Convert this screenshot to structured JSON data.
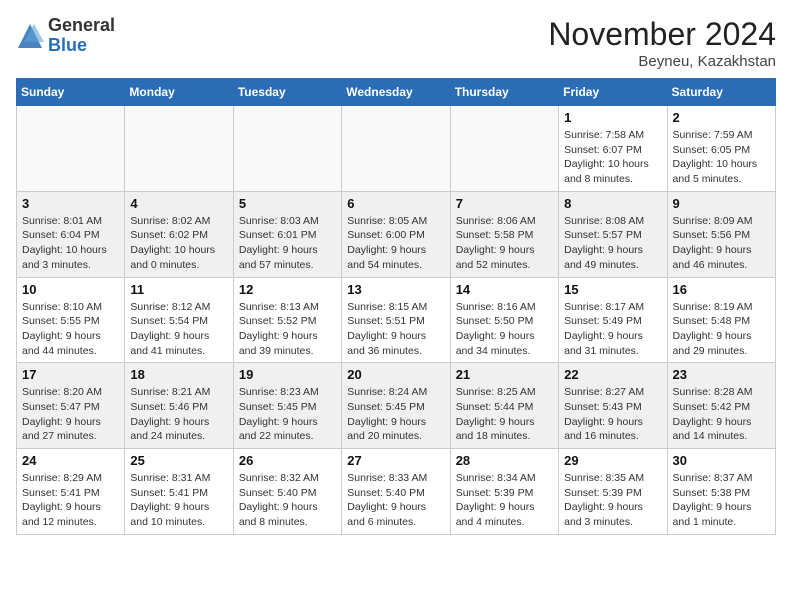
{
  "header": {
    "logo": {
      "general": "General",
      "blue": "Blue"
    },
    "title": "November 2024",
    "location": "Beyneu, Kazakhstan"
  },
  "weekdays": [
    "Sunday",
    "Monday",
    "Tuesday",
    "Wednesday",
    "Thursday",
    "Friday",
    "Saturday"
  ],
  "weeks": [
    {
      "shaded": false,
      "days": [
        {
          "date": "",
          "sunrise": "",
          "sunset": "",
          "daylight": ""
        },
        {
          "date": "",
          "sunrise": "",
          "sunset": "",
          "daylight": ""
        },
        {
          "date": "",
          "sunrise": "",
          "sunset": "",
          "daylight": ""
        },
        {
          "date": "",
          "sunrise": "",
          "sunset": "",
          "daylight": ""
        },
        {
          "date": "",
          "sunrise": "",
          "sunset": "",
          "daylight": ""
        },
        {
          "date": "1",
          "sunrise": "Sunrise: 7:58 AM",
          "sunset": "Sunset: 6:07 PM",
          "daylight": "Daylight: 10 hours and 8 minutes."
        },
        {
          "date": "2",
          "sunrise": "Sunrise: 7:59 AM",
          "sunset": "Sunset: 6:05 PM",
          "daylight": "Daylight: 10 hours and 5 minutes."
        }
      ]
    },
    {
      "shaded": true,
      "days": [
        {
          "date": "3",
          "sunrise": "Sunrise: 8:01 AM",
          "sunset": "Sunset: 6:04 PM",
          "daylight": "Daylight: 10 hours and 3 minutes."
        },
        {
          "date": "4",
          "sunrise": "Sunrise: 8:02 AM",
          "sunset": "Sunset: 6:02 PM",
          "daylight": "Daylight: 10 hours and 0 minutes."
        },
        {
          "date": "5",
          "sunrise": "Sunrise: 8:03 AM",
          "sunset": "Sunset: 6:01 PM",
          "daylight": "Daylight: 9 hours and 57 minutes."
        },
        {
          "date": "6",
          "sunrise": "Sunrise: 8:05 AM",
          "sunset": "Sunset: 6:00 PM",
          "daylight": "Daylight: 9 hours and 54 minutes."
        },
        {
          "date": "7",
          "sunrise": "Sunrise: 8:06 AM",
          "sunset": "Sunset: 5:58 PM",
          "daylight": "Daylight: 9 hours and 52 minutes."
        },
        {
          "date": "8",
          "sunrise": "Sunrise: 8:08 AM",
          "sunset": "Sunset: 5:57 PM",
          "daylight": "Daylight: 9 hours and 49 minutes."
        },
        {
          "date": "9",
          "sunrise": "Sunrise: 8:09 AM",
          "sunset": "Sunset: 5:56 PM",
          "daylight": "Daylight: 9 hours and 46 minutes."
        }
      ]
    },
    {
      "shaded": false,
      "days": [
        {
          "date": "10",
          "sunrise": "Sunrise: 8:10 AM",
          "sunset": "Sunset: 5:55 PM",
          "daylight": "Daylight: 9 hours and 44 minutes."
        },
        {
          "date": "11",
          "sunrise": "Sunrise: 8:12 AM",
          "sunset": "Sunset: 5:54 PM",
          "daylight": "Daylight: 9 hours and 41 minutes."
        },
        {
          "date": "12",
          "sunrise": "Sunrise: 8:13 AM",
          "sunset": "Sunset: 5:52 PM",
          "daylight": "Daylight: 9 hours and 39 minutes."
        },
        {
          "date": "13",
          "sunrise": "Sunrise: 8:15 AM",
          "sunset": "Sunset: 5:51 PM",
          "daylight": "Daylight: 9 hours and 36 minutes."
        },
        {
          "date": "14",
          "sunrise": "Sunrise: 8:16 AM",
          "sunset": "Sunset: 5:50 PM",
          "daylight": "Daylight: 9 hours and 34 minutes."
        },
        {
          "date": "15",
          "sunrise": "Sunrise: 8:17 AM",
          "sunset": "Sunset: 5:49 PM",
          "daylight": "Daylight: 9 hours and 31 minutes."
        },
        {
          "date": "16",
          "sunrise": "Sunrise: 8:19 AM",
          "sunset": "Sunset: 5:48 PM",
          "daylight": "Daylight: 9 hours and 29 minutes."
        }
      ]
    },
    {
      "shaded": true,
      "days": [
        {
          "date": "17",
          "sunrise": "Sunrise: 8:20 AM",
          "sunset": "Sunset: 5:47 PM",
          "daylight": "Daylight: 9 hours and 27 minutes."
        },
        {
          "date": "18",
          "sunrise": "Sunrise: 8:21 AM",
          "sunset": "Sunset: 5:46 PM",
          "daylight": "Daylight: 9 hours and 24 minutes."
        },
        {
          "date": "19",
          "sunrise": "Sunrise: 8:23 AM",
          "sunset": "Sunset: 5:45 PM",
          "daylight": "Daylight: 9 hours and 22 minutes."
        },
        {
          "date": "20",
          "sunrise": "Sunrise: 8:24 AM",
          "sunset": "Sunset: 5:45 PM",
          "daylight": "Daylight: 9 hours and 20 minutes."
        },
        {
          "date": "21",
          "sunrise": "Sunrise: 8:25 AM",
          "sunset": "Sunset: 5:44 PM",
          "daylight": "Daylight: 9 hours and 18 minutes."
        },
        {
          "date": "22",
          "sunrise": "Sunrise: 8:27 AM",
          "sunset": "Sunset: 5:43 PM",
          "daylight": "Daylight: 9 hours and 16 minutes."
        },
        {
          "date": "23",
          "sunrise": "Sunrise: 8:28 AM",
          "sunset": "Sunset: 5:42 PM",
          "daylight": "Daylight: 9 hours and 14 minutes."
        }
      ]
    },
    {
      "shaded": false,
      "days": [
        {
          "date": "24",
          "sunrise": "Sunrise: 8:29 AM",
          "sunset": "Sunset: 5:41 PM",
          "daylight": "Daylight: 9 hours and 12 minutes."
        },
        {
          "date": "25",
          "sunrise": "Sunrise: 8:31 AM",
          "sunset": "Sunset: 5:41 PM",
          "daylight": "Daylight: 9 hours and 10 minutes."
        },
        {
          "date": "26",
          "sunrise": "Sunrise: 8:32 AM",
          "sunset": "Sunset: 5:40 PM",
          "daylight": "Daylight: 9 hours and 8 minutes."
        },
        {
          "date": "27",
          "sunrise": "Sunrise: 8:33 AM",
          "sunset": "Sunset: 5:40 PM",
          "daylight": "Daylight: 9 hours and 6 minutes."
        },
        {
          "date": "28",
          "sunrise": "Sunrise: 8:34 AM",
          "sunset": "Sunset: 5:39 PM",
          "daylight": "Daylight: 9 hours and 4 minutes."
        },
        {
          "date": "29",
          "sunrise": "Sunrise: 8:35 AM",
          "sunset": "Sunset: 5:39 PM",
          "daylight": "Daylight: 9 hours and 3 minutes."
        },
        {
          "date": "30",
          "sunrise": "Sunrise: 8:37 AM",
          "sunset": "Sunset: 5:38 PM",
          "daylight": "Daylight: 9 hours and 1 minute."
        }
      ]
    }
  ]
}
